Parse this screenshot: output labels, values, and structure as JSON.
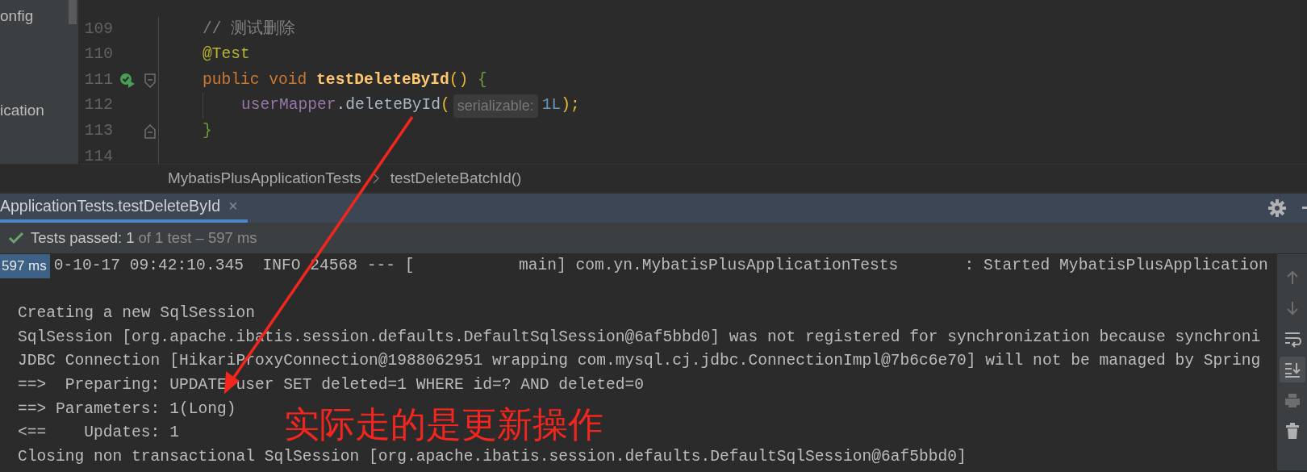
{
  "project_panel": {
    "items": [
      "onfig",
      "ication"
    ]
  },
  "editor": {
    "lines": [
      {
        "number": "109",
        "tokens": [
          {
            "kind": "comment",
            "text": "// 测试删除"
          }
        ]
      },
      {
        "number": "110",
        "tokens": [
          {
            "kind": "annotation",
            "text": "@Test"
          }
        ]
      },
      {
        "number": "111",
        "run_marker": true,
        "fold_start": true,
        "tokens": [
          {
            "kind": "keyword",
            "text": "public void "
          },
          {
            "kind": "method",
            "text": "testDeleteById"
          },
          {
            "kind": "paren",
            "text": "()"
          },
          {
            "kind": "brace",
            "text": " {"
          }
        ]
      },
      {
        "number": "112",
        "indented": true,
        "tokens": [
          {
            "kind": "field",
            "text": "userMapper"
          },
          {
            "kind": "plain",
            "text": ".deleteById"
          },
          {
            "kind": "paren",
            "text": "("
          },
          {
            "kind": "hint",
            "text": "serializable:"
          },
          {
            "kind": "number",
            "text": "1L"
          },
          {
            "kind": "paren",
            "text": ");"
          }
        ]
      },
      {
        "number": "113",
        "fold_end": true,
        "tokens": [
          {
            "kind": "brace",
            "text": "}"
          }
        ]
      },
      {
        "number": "114"
      }
    ]
  },
  "breadcrumb": [
    "MybatisPlusApplicationTests",
    "testDeleteBatchId()"
  ],
  "run_panel": {
    "tab": {
      "label": "ApplicationTests.testDeleteById",
      "close": "×",
      "selected": true
    },
    "status": {
      "passed": "Tests passed: 1",
      "detail": "of 1 test – 597 ms"
    },
    "duration_badge": "597 ms",
    "console_lines": [
      {
        "text": "0-10-17 09:42:10.345  INFO 24568 --- [           main] com.yn.MybatisPlusApplicationTests       : Started MybatisPlusApplication"
      },
      {
        "text": "Creating a new SqlSession",
        "gap_before": true
      },
      {
        "text": "SqlSession [org.apache.ibatis.session.defaults.DefaultSqlSession@6af5bbd0] was not registered for synchronization because synchroni"
      },
      {
        "text": "JDBC Connection [HikariProxyConnection@1988062951 wrapping com.mysql.cj.jdbc.ConnectionImpl@7b6c6e70] will not be managed by Spring"
      },
      {
        "text": "==>  Preparing: UPDATE user SET deleted=1 WHERE id=? AND deleted=0"
      },
      {
        "text": "==> Parameters: 1(Long)"
      },
      {
        "text": "<==    Updates: 1"
      },
      {
        "text": "Closing non transactional SqlSession [org.apache.ibatis.session.defaults.DefaultSqlSession@6af5bbd0]"
      }
    ],
    "toolbar": [
      {
        "kind": "up",
        "selected": false
      },
      {
        "kind": "down",
        "selected": false
      },
      {
        "kind": "wrap",
        "selected": false
      },
      {
        "kind": "scroll-end",
        "selected": true
      },
      {
        "kind": "print",
        "selected": false
      },
      {
        "kind": "trash",
        "selected": false
      }
    ]
  },
  "annotation": {
    "text": "实际走的是更新操作"
  }
}
